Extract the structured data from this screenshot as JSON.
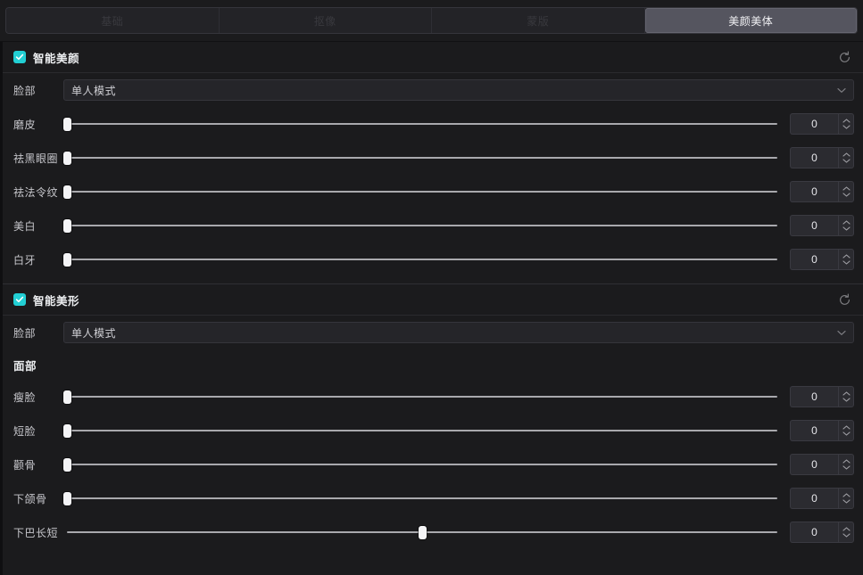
{
  "tabs": [
    {
      "label": "基础",
      "active": false
    },
    {
      "label": "抠像",
      "active": false
    },
    {
      "label": "蒙版",
      "active": false
    },
    {
      "label": "美颜美体",
      "active": true
    }
  ],
  "sections": [
    {
      "id": "smart-beauty",
      "title": "智能美颜",
      "checked": true,
      "reset_icon": "reset-icon",
      "select_label": "脸部",
      "select_value": "单人模式",
      "sliders": [
        {
          "label": "磨皮",
          "value": "0",
          "pos": 0
        },
        {
          "label": "祛黑眼圈",
          "value": "0",
          "pos": 0
        },
        {
          "label": "祛法令纹",
          "value": "0",
          "pos": 0
        },
        {
          "label": "美白",
          "value": "0",
          "pos": 0
        },
        {
          "label": "白牙",
          "value": "0",
          "pos": 0
        }
      ]
    },
    {
      "id": "smart-reshape",
      "title": "智能美形",
      "checked": true,
      "reset_icon": "reset-icon",
      "select_label": "脸部",
      "select_value": "单人模式",
      "subhead": "面部",
      "sliders": [
        {
          "label": "瘦脸",
          "value": "0",
          "pos": 0
        },
        {
          "label": "短脸",
          "value": "0",
          "pos": 0
        },
        {
          "label": "颧骨",
          "value": "0",
          "pos": 0
        },
        {
          "label": "下颌骨",
          "value": "0",
          "pos": 0
        },
        {
          "label": "下巴长短",
          "value": "0",
          "pos": 50
        }
      ]
    }
  ],
  "colors": {
    "accent": "#22cfd4",
    "panel_bg": "#1b1b1d",
    "tab_active_bg": "#55555f",
    "tab_inactive_text": "#39393e",
    "field_bg": "#2b2b30"
  }
}
